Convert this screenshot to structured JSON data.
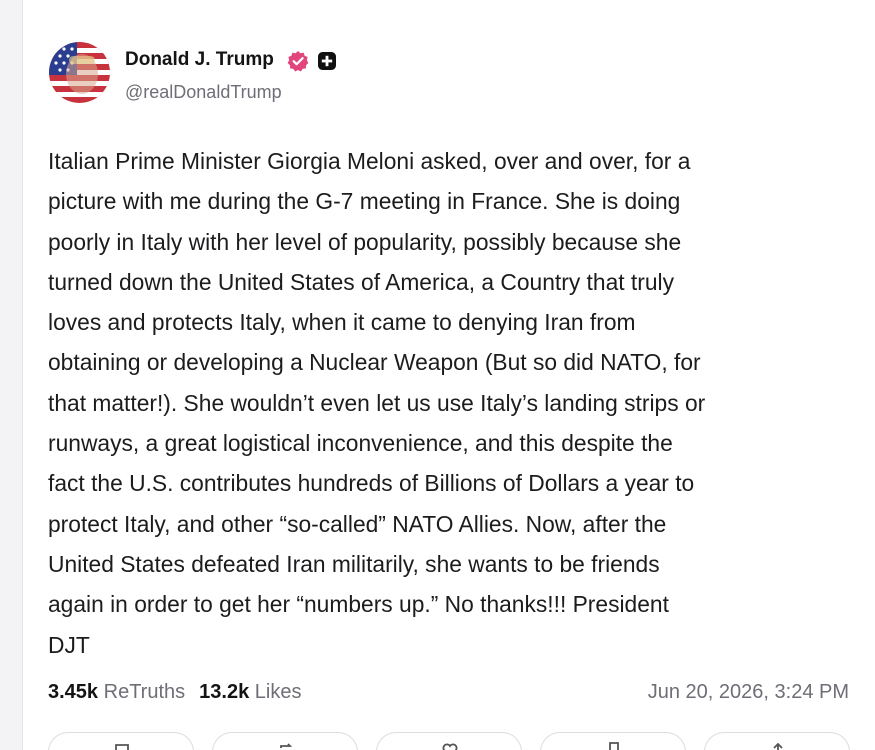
{
  "post": {
    "author": {
      "display_name": "Donald J. Trump",
      "handle": "@realDonaldTrump",
      "verified_icon": "verified-badge-icon",
      "extra_icon": "plus-badge-icon",
      "badge_color": "#e0457b"
    },
    "body_lines": [
      "Italian Prime Minister Giorgia Meloni asked, over and over, for a",
      "picture with me during the G-7 meeting in France. She is doing",
      "poorly in Italy with her level of popularity, possibly because she",
      "turned down the United States of America, a Country that truly",
      "loves and protects Italy, when it came to denying Iran from",
      "obtaining or developing a Nuclear Weapon (But so did NATO, for",
      "that matter!). She wouldn’t even let us use Italy’s landing strips or",
      "runways, a great logistical inconvenience, and this despite the",
      "fact the U.S. contributes hundreds of Billions of Dollars a year to",
      "protect Italy, and other “so-called” NATO Allies. Now, after the",
      "United States defeated Iran militarily, she wants to be friends",
      "again in order to get her “numbers up.” No thanks!!! President",
      "DJT"
    ],
    "stats": {
      "retruths_count": "3.45k",
      "retruths_label": "ReTruths",
      "likes_count": "13.2k",
      "likes_label": "Likes"
    },
    "timestamp": "Jun 20, 2026, 3:24 PM",
    "actions": [
      {
        "icon": "reply-icon"
      },
      {
        "icon": "retruth-icon"
      },
      {
        "icon": "like-icon"
      },
      {
        "icon": "bookmark-icon"
      },
      {
        "icon": "share-icon"
      }
    ]
  }
}
